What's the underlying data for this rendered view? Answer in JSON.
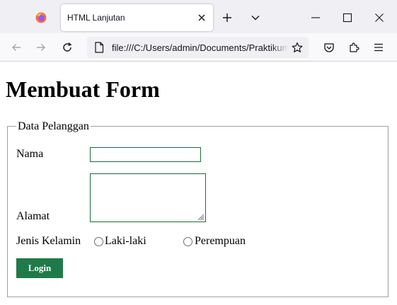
{
  "browser": {
    "tab": {
      "title": "HTML Lanjutan"
    },
    "url": "file:///C:/Users/admin/Documents/Praktikum",
    "icons": [
      "firefox-logo",
      "close-tab-icon",
      "new-tab-icon",
      "list-all-tabs-icon",
      "minimize-icon",
      "maximize-icon",
      "window-close-icon",
      "back-icon",
      "forward-icon",
      "reload-icon",
      "page-icon",
      "bookmark-star-icon",
      "pocket-icon",
      "extensions-icon",
      "menu-icon"
    ]
  },
  "page": {
    "heading": "Membuat Form",
    "form": {
      "legend": "Data Pelanggan",
      "nama_label": "Nama",
      "nama_value": "",
      "alamat_label": "Alamat",
      "alamat_value": "",
      "jenis_kelamin_label": "Jenis Kelamin",
      "gender_options": [
        "Laki-laki",
        "Perempuan"
      ],
      "submit_label": "Login"
    }
  },
  "colors": {
    "accent_green": "#1f7a49",
    "input_border": "#1d6b45",
    "chrome_bg": "#f0f0f4"
  }
}
